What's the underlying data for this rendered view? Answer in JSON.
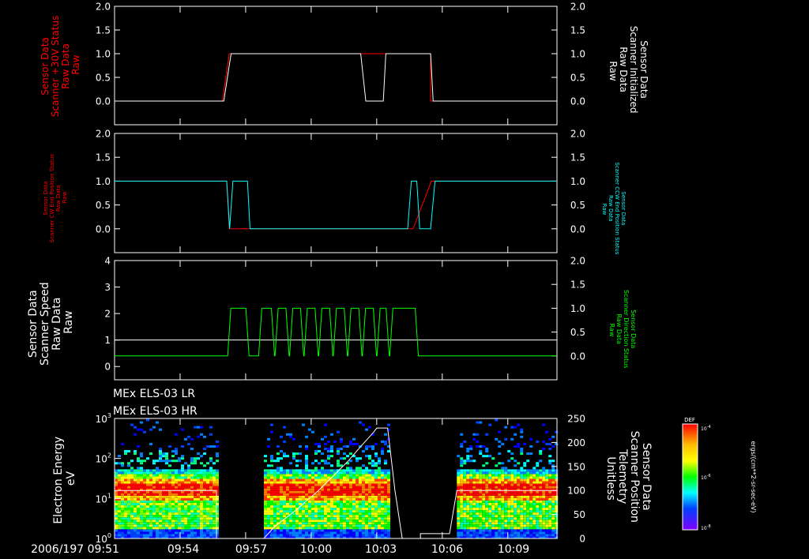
{
  "chart_data": [
    {
      "type": "line",
      "left_axis": {
        "label_lines": [
          "Sensor Data",
          "Scanner +30V Status",
          "Raw Data",
          "Raw"
        ],
        "color": "#ff0000",
        "ylim": [
          -0.5,
          2.0
        ],
        "ticks": [
          "0.0",
          "0.5",
          "1.0",
          "1.5",
          "2.0"
        ]
      },
      "right_axis": {
        "label_lines": [
          "Sensor Data",
          "Scanner Initialized",
          "Raw Data",
          "Raw"
        ],
        "color": "#ffffff",
        "ylim": [
          -0.5,
          2.0
        ],
        "ticks": [
          "0.0",
          "0.5",
          "1.0",
          "1.5",
          "2.0"
        ]
      },
      "series": [
        {
          "color": "#ff0000",
          "axis": "left",
          "points": [
            [
              "09:51",
              0
            ],
            [
              "09:55:56",
              0
            ],
            [
              "09:56:15",
              1
            ],
            [
              "10:02:16",
              1
            ],
            [
              "10:02:30",
              1
            ],
            [
              "10:03:25",
              1
            ],
            [
              "10:05:28",
              1
            ],
            [
              "10:05:28",
              0
            ],
            [
              "10:11:15",
              0
            ]
          ]
        },
        {
          "color": "#ffffff",
          "axis": "right",
          "points": [
            [
              "09:51",
              0
            ],
            [
              "09:56:00",
              0
            ],
            [
              "09:56:20",
              1
            ],
            [
              "10:02:16",
              1
            ],
            [
              "10:02:30",
              0
            ],
            [
              "10:03:18",
              0
            ],
            [
              "10:03:25",
              1
            ],
            [
              "10:05:28",
              1
            ],
            [
              "10:05:35",
              0
            ],
            [
              "10:11:15",
              0
            ]
          ]
        }
      ]
    },
    {
      "type": "line",
      "left_axis": {
        "label_lines": [
          "Sensor Data",
          "Scanner CW End Position Status",
          "Raw Data",
          "Raw"
        ],
        "color": "#ff0000",
        "ylim": [
          -0.5,
          2.0
        ],
        "ticks": [
          "0.0",
          "0.5",
          "1.0",
          "1.5",
          "2.0"
        ]
      },
      "right_axis": {
        "label_lines": [
          "Sensor Data",
          "Scanner CCW End Position Status",
          "Raw Data",
          "Raw"
        ],
        "color": "#00ffff",
        "ylim": [
          -0.5,
          2.0
        ],
        "ticks": [
          "0.0",
          "0.5",
          "1.0",
          "1.5",
          "2.0"
        ]
      },
      "series": [
        {
          "color": "#ff0000",
          "axis": "left",
          "points": [
            [
              "09:51",
              1
            ],
            [
              "09:56:08",
              1
            ],
            [
              "09:56:15",
              0
            ],
            [
              "09:56:40",
              0
            ],
            [
              "09:57:05",
              0
            ],
            [
              "10:04:10",
              0
            ],
            [
              "10:04:40",
              0
            ],
            [
              "10:05:30",
              1
            ],
            [
              "10:11:15",
              1
            ]
          ]
        },
        {
          "color": "#00ffff",
          "axis": "right",
          "points": [
            [
              "09:51",
              1
            ],
            [
              "09:56:08",
              1
            ],
            [
              "09:56:16",
              0
            ],
            [
              "09:56:25",
              1
            ],
            [
              "09:57:05",
              1
            ],
            [
              "09:57:12",
              0
            ],
            [
              "10:04:25",
              0
            ],
            [
              "10:04:35",
              1
            ],
            [
              "10:04:50",
              1
            ],
            [
              "10:04:58",
              0
            ],
            [
              "10:05:28",
              0
            ],
            [
              "10:05:40",
              1
            ],
            [
              "10:11:15",
              1
            ]
          ]
        }
      ]
    },
    {
      "type": "line",
      "left_axis": {
        "label_lines": [
          "Sensor Data",
          "Scanner Speed",
          "Raw Data",
          "Raw"
        ],
        "color": "#ffffff",
        "ylim": [
          -0.5,
          4.0
        ],
        "ticks": [
          "0",
          "1",
          "2",
          "3",
          "4"
        ]
      },
      "right_axis": {
        "label_lines": [
          "Sensor Data",
          "Scanner Direction Status",
          "Raw Data",
          "Raw"
        ],
        "color": "#00ff00",
        "ylim": [
          -0.5,
          2.0
        ],
        "ticks": [
          "0.0",
          "0.5",
          "1.0",
          "1.5",
          "2.0"
        ]
      },
      "series": [
        {
          "color": "#ffffff",
          "axis": "left",
          "points": [
            [
              "09:51",
              1
            ],
            [
              "10:11:15",
              1
            ]
          ]
        },
        {
          "color": "#00ff00",
          "axis": "right",
          "description_free": true,
          "square_wave": {
            "start": "09:51",
            "end": "10:11:15",
            "low": 0,
            "high": 1,
            "highs": [
              [
                "09:56:15",
                "09:57:05"
              ],
              [
                "09:57:40",
                "09:58:15"
              ],
              [
                "09:58:25",
                "09:58:55"
              ],
              [
                "09:59:05",
                "09:59:35"
              ],
              [
                "09:59:45",
                "10:00:15"
              ],
              [
                "10:00:25",
                "10:00:55"
              ],
              [
                "10:01:05",
                "10:01:35"
              ],
              [
                "10:01:45",
                "10:02:15"
              ],
              [
                "10:02:25",
                "10:02:55"
              ],
              [
                "10:03:05",
                "10:03:30"
              ],
              [
                "10:03:40",
                "10:04:50"
              ]
            ]
          }
        }
      ]
    },
    {
      "type": "heatmap",
      "title_lines": [
        "MEx ELS-03 LR",
        "MEx ELS-03 HR"
      ],
      "ylabel_lines": [
        "Electron Energy",
        "eV"
      ],
      "y_log_range": [
        1,
        1000
      ],
      "y_ticks": [
        "10^0",
        "10^1",
        "10^2",
        "10^3"
      ],
      "right_axis": {
        "label_lines": [
          "Sensor Data",
          "Scanner Position",
          "Telemetry",
          "Unitless"
        ],
        "ylim": [
          0,
          250
        ],
        "ticks": [
          "0",
          "50",
          "100",
          "150",
          "200",
          "250"
        ]
      },
      "colorbar": {
        "title": "DEF",
        "ticks": [
          "10^-4",
          "10^-6",
          "10^-8"
        ],
        "units": "ergs/(cm**2-sr-sec-eV)"
      },
      "data_blocks": [
        [
          "09:51",
          "09:55:40"
        ],
        [
          "09:57:50",
          "10:03:30"
        ],
        [
          "10:06:40",
          "10:11:15"
        ]
      ],
      "scanner_position": [
        [
          "09:51",
          100
        ],
        [
          "09:55:40",
          100
        ],
        [
          "09:55:40",
          0
        ],
        [
          "09:57:50",
          0
        ],
        [
          "09:58:20",
          25
        ],
        [
          "09:59:20",
          60
        ],
        [
          "10:00:20",
          100
        ],
        [
          "10:01:00",
          130
        ],
        [
          "10:01:40",
          160
        ],
        [
          "10:02:20",
          195
        ],
        [
          "10:02:50",
          220
        ],
        [
          "10:03:00",
          230
        ],
        [
          "10:03:30",
          230
        ],
        [
          "10:03:50",
          100
        ],
        [
          "10:04:10",
          0
        ],
        [
          "10:05:00",
          0
        ],
        [
          "10:05:00",
          10
        ],
        [
          "10:06:20",
          10
        ],
        [
          "10:06:40",
          100
        ],
        [
          "10:11:15",
          100
        ]
      ]
    }
  ],
  "time_axis": {
    "start": "09:51",
    "end": "10:11:15",
    "labels": [
      "2006/197 09:51",
      "09:54",
      "09:57",
      "10:00",
      "10:03",
      "10:06",
      "10:09"
    ],
    "label_times": [
      "09:51",
      "09:54",
      "09:57",
      "10:00",
      "10:03",
      "10:06",
      "10:09"
    ]
  }
}
